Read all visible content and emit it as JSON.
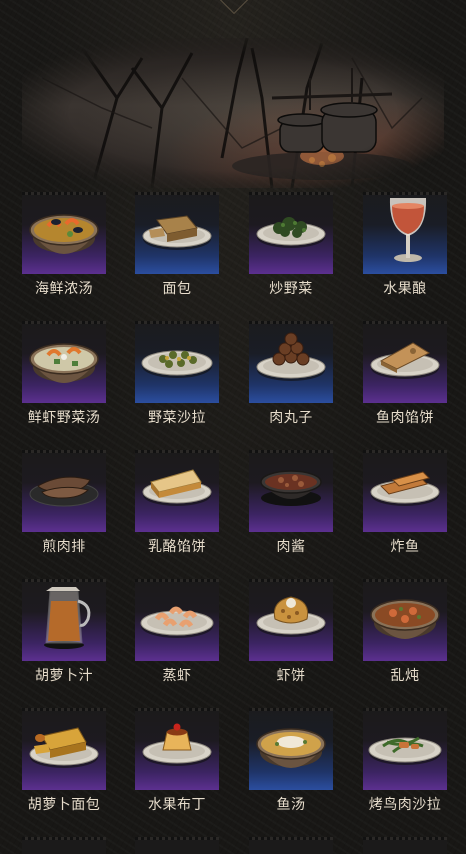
{
  "scene": {
    "banner_icon": "campfire-cauldron-forest-icon"
  },
  "colors": {
    "rarity_purple": "#5c3090",
    "rarity_blue": "#2b4ea0",
    "label_text": "#e6dccb",
    "background": "#181715"
  },
  "recipes": [
    {
      "name": "海鲜浓汤",
      "rarity": "purple",
      "icon": "seafood-soup-icon"
    },
    {
      "name": "面包",
      "rarity": "blue",
      "icon": "bread-icon"
    },
    {
      "name": "炒野菜",
      "rarity": "purple",
      "icon": "fried-greens-icon"
    },
    {
      "name": "水果酿",
      "rarity": "blue",
      "icon": "fruit-wine-icon"
    },
    {
      "name": "鲜虾野菜汤",
      "rarity": "purple",
      "icon": "shrimp-vegetable-soup-icon"
    },
    {
      "name": "野菜沙拉",
      "rarity": "blue",
      "icon": "vegetable-salad-icon"
    },
    {
      "name": "肉丸子",
      "rarity": "blue",
      "icon": "meatballs-icon"
    },
    {
      "name": "鱼肉馅饼",
      "rarity": "purple",
      "icon": "fish-pie-icon"
    },
    {
      "name": "煎肉排",
      "rarity": "purple",
      "icon": "fried-steak-icon"
    },
    {
      "name": "乳酪馅饼",
      "rarity": "purple",
      "icon": "cheese-pie-icon"
    },
    {
      "name": "肉酱",
      "rarity": "purple",
      "icon": "meat-sauce-icon"
    },
    {
      "name": "炸鱼",
      "rarity": "purple",
      "icon": "fried-fish-icon"
    },
    {
      "name": "胡萝卜汁",
      "rarity": "purple",
      "icon": "carrot-juice-icon"
    },
    {
      "name": "蒸虾",
      "rarity": "purple",
      "icon": "steamed-shrimp-icon"
    },
    {
      "name": "虾饼",
      "rarity": "purple",
      "icon": "shrimp-cake-icon"
    },
    {
      "name": "乱炖",
      "rarity": "purple",
      "icon": "stew-icon"
    },
    {
      "name": "胡萝卜面包",
      "rarity": "purple",
      "icon": "carrot-bread-icon"
    },
    {
      "name": "水果布丁",
      "rarity": "purple",
      "icon": "fruit-pudding-icon"
    },
    {
      "name": "鱼汤",
      "rarity": "blue",
      "icon": "fish-soup-icon"
    },
    {
      "name": "烤鸟肉沙拉",
      "rarity": "purple",
      "icon": "roast-bird-salad-icon"
    }
  ]
}
